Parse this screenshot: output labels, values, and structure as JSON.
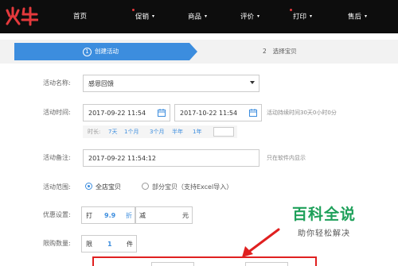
{
  "nav": {
    "logo_text": "火牛",
    "items": [
      {
        "label": "首页",
        "has_caret": false,
        "has_dot": false
      },
      {
        "label": "促销",
        "has_caret": true,
        "has_dot": true
      },
      {
        "label": "商品",
        "has_caret": true,
        "has_dot": false
      },
      {
        "label": "评价",
        "has_caret": true,
        "has_dot": false
      },
      {
        "label": "打印",
        "has_caret": true,
        "has_dot": true
      },
      {
        "label": "售后",
        "has_caret": true,
        "has_dot": false
      }
    ],
    "caret": "▾"
  },
  "steps": {
    "step1": {
      "num": "1",
      "label": "创建活动"
    },
    "step2": {
      "num": "2",
      "label": "选择宝贝"
    }
  },
  "form": {
    "name_label": "活动名称:",
    "name_value": "感恩回馈",
    "time_label": "活动时间:",
    "start_time": "2017-09-22 11:54",
    "end_time": "2017-10-22 11:54",
    "time_hint": "活动持续时间30天0小时0分",
    "duration_label": "时长:",
    "duration_options": [
      "7天",
      "1个月",
      "3个月",
      "半年",
      "1年"
    ],
    "note_label": "活动备注:",
    "note_value": "2017-09-22 11:54:12",
    "note_hint": "只在软件内显示",
    "scope_label": "活动范围:",
    "scope_all": "全店宝贝",
    "scope_partial": "部分宝贝（支持Excel导入）",
    "discount_label": "优惠设置:",
    "discount_prefix": "打",
    "discount_value": "9.9",
    "discount_suffix": "折",
    "reduce_prefix": "减",
    "reduce_suffix": "元",
    "limit_label": "限购数量:",
    "limit_prefix": "限",
    "limit_value": "1",
    "limit_suffix": "件"
  },
  "watermark": {
    "title": "百科全说",
    "subtitle": "助你轻松解决"
  },
  "colors": {
    "nav_bg": "#0d0d0d",
    "brand_red": "#e4393c",
    "step_active": "#3c8dde",
    "link_blue": "#3c8dde",
    "watermark_green": "#1ea05a",
    "annotation_red": "#e02020"
  }
}
